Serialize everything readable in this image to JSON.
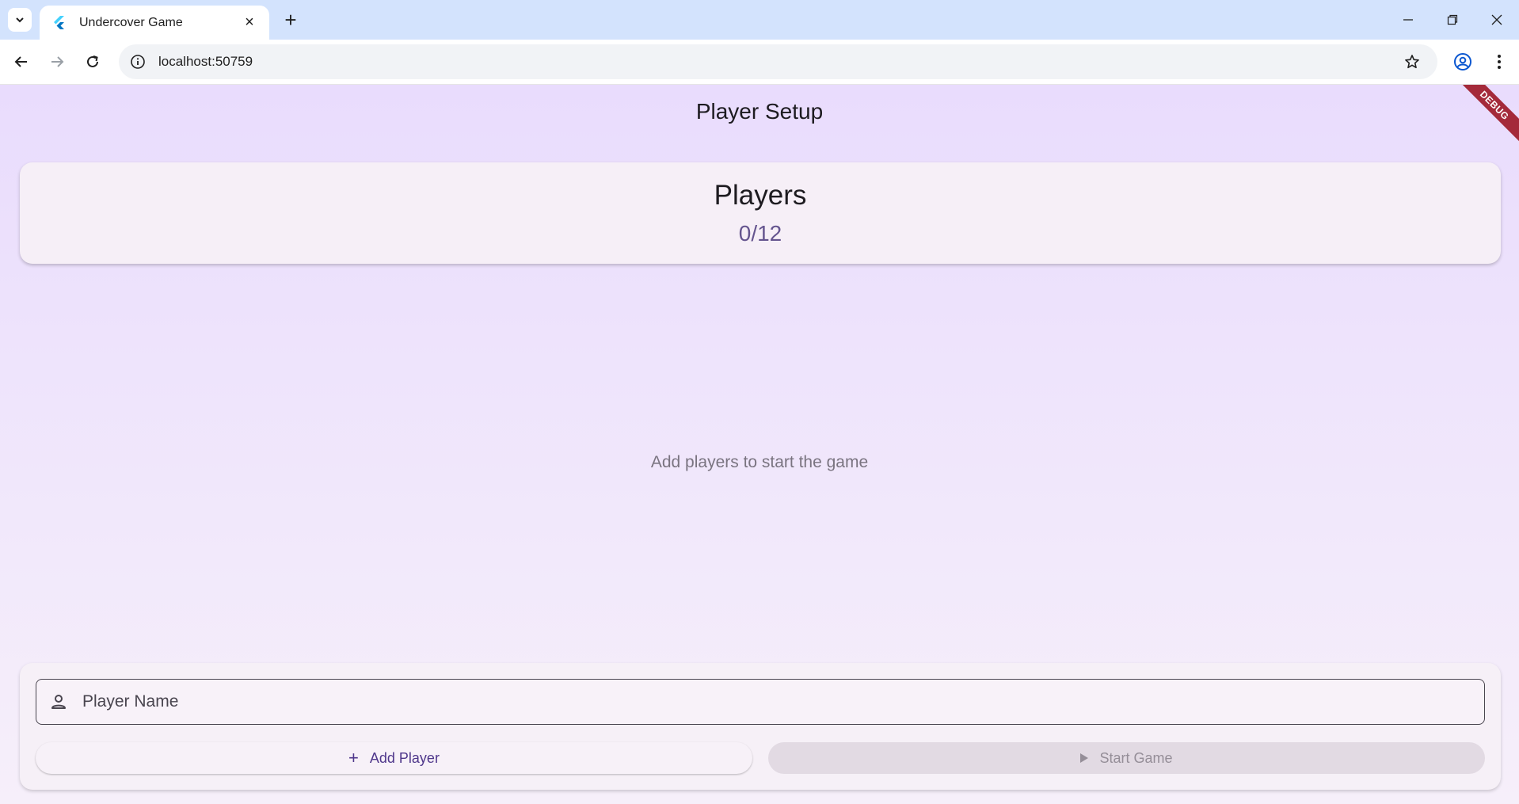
{
  "browser": {
    "tab_title": "Undercover Game",
    "new_tab_label": "+",
    "close_tab_label": "×",
    "url": "localhost:50759"
  },
  "app": {
    "title": "Player Setup",
    "debug_banner": "DEBUG",
    "players_card": {
      "heading": "Players",
      "count": "0/12"
    },
    "empty_message": "Add players to start the game",
    "input": {
      "placeholder": "Player Name",
      "value": ""
    },
    "buttons": {
      "add_player": "Add Player",
      "start_game": "Start Game"
    }
  },
  "colors": {
    "accent": "#65558f",
    "primary": "#4f378b",
    "debug_banner": "#a42a3a"
  }
}
